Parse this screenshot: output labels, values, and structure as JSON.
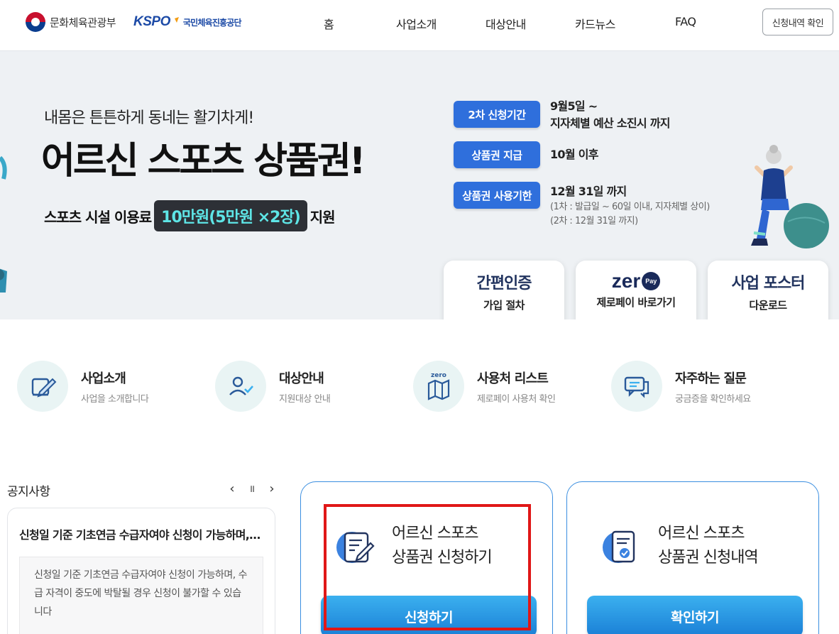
{
  "header": {
    "org1": "문화체육관광부",
    "org2_mark": "KSPO",
    "org2": "국민체육진흥공단",
    "nav": [
      "홈",
      "사업소개",
      "대상안내",
      "카드뉴스",
      "FAQ"
    ],
    "check_btn": "신청내역 확인"
  },
  "hero": {
    "subtitle": "내몸은 튼튼하게 동네는 활기차게!",
    "title": "어르신 스포츠 상품권!",
    "desc_prefix": "스포츠 시설 이용료",
    "desc_chip": "10만원(5만원 ×2장)",
    "desc_suffix": "지원",
    "info": [
      {
        "badge": "2차 신청기간",
        "line1": "9월5일 ~",
        "line2": "지자체별 예산 소진시 까지"
      },
      {
        "badge": "상품권 지급",
        "line1": "10월 이후"
      },
      {
        "badge": "상품권 사용기한",
        "line1": "12월 31일 까지",
        "note1": "(1차 : 발급일 ~ 60일 이내, 지자체별 상이)",
        "note2": "(2차 : 12월 31일 까지)"
      }
    ],
    "quick": [
      {
        "big": "간편인증",
        "small": "가입 절차"
      },
      {
        "big": "zer",
        "pay": "Pay",
        "small": "제로페이 바로가기"
      },
      {
        "big": "사업 포스터",
        "small": "다운로드"
      }
    ]
  },
  "shortcuts": [
    {
      "title": "사업소개",
      "sub": "사업을 소개합니다",
      "icon": "board-pencil-icon"
    },
    {
      "title": "대상안내",
      "sub": "지원대상 안내",
      "icon": "user-check-icon"
    },
    {
      "title": "사용처 리스트",
      "sub": "제로페이 사용처 확인",
      "icon": "map-icon",
      "icon_label": "zero"
    },
    {
      "title": "자주하는 질문",
      "sub": "궁금증을 확인하세요",
      "icon": "chat-bubbles-icon"
    }
  ],
  "notice": {
    "heading": "공지사항",
    "prev": "‹",
    "pause": "॥",
    "next": "›",
    "title": "신청일 기준 기초연금 수급자여야 신청이 가능하며, 수급 자격이 중도에 박탈될 경우 신청이 불가할 수 있습니다",
    "body": "신청일 기준 기초연금 수급자여야 신청이 가능하며, 수급 자격이 중도에 박탈될 경우 신청이 불가할 수 있습니다"
  },
  "actions": [
    {
      "line1": "어르신 스포츠",
      "line2": "상품권 신청하기",
      "button": "신청하기"
    },
    {
      "line1": "어르신 스포츠",
      "line2": "상품권 신청내역",
      "button": "확인하기"
    }
  ],
  "colors": {
    "accent": "#2f6fdc",
    "button": "#1a7fd6",
    "highlight": "#e01717",
    "chip_text": "#5ee5e6"
  }
}
